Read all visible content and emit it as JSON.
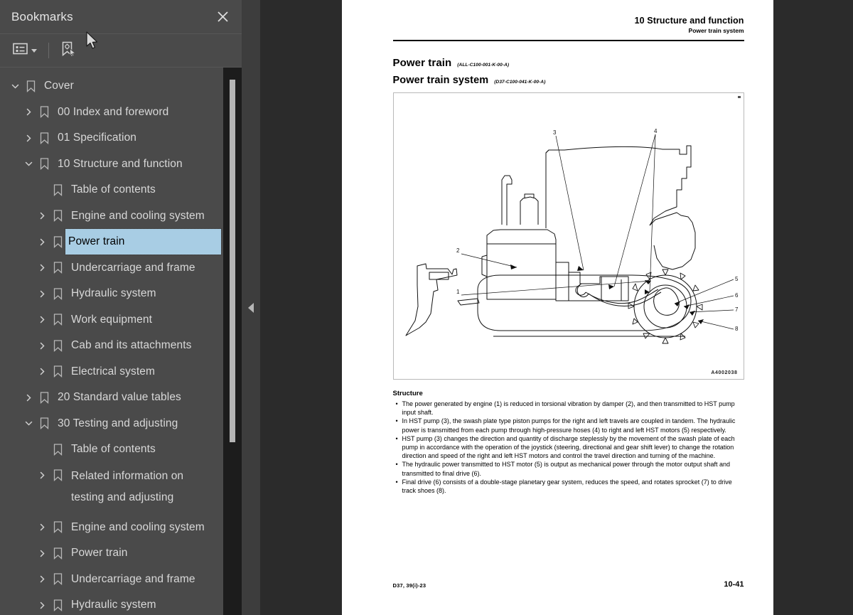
{
  "panel": {
    "title": "Bookmarks",
    "close_icon": "close-icon",
    "toolbar": {
      "list_options_label": "list-options-icon",
      "new_bookmark_label": "new-bookmark-icon"
    }
  },
  "bookmarks": [
    {
      "label": "Cover",
      "depth": 0,
      "state": "expanded"
    },
    {
      "label": "00 Index and foreword",
      "depth": 1,
      "state": "collapsed"
    },
    {
      "label": "01 Specification",
      "depth": 1,
      "state": "collapsed"
    },
    {
      "label": "10 Structure and function",
      "depth": 1,
      "state": "expanded"
    },
    {
      "label": "Table of contents",
      "depth": 2,
      "state": "leaf"
    },
    {
      "label": "Engine and cooling system",
      "depth": 2,
      "state": "collapsed"
    },
    {
      "label": "Power train",
      "depth": 2,
      "state": "collapsed",
      "selected": true
    },
    {
      "label": "Undercarriage and frame",
      "depth": 2,
      "state": "collapsed"
    },
    {
      "label": "Hydraulic system",
      "depth": 2,
      "state": "collapsed"
    },
    {
      "label": "Work equipment",
      "depth": 2,
      "state": "collapsed"
    },
    {
      "label": "Cab and its attachments",
      "depth": 2,
      "state": "collapsed"
    },
    {
      "label": "Electrical system",
      "depth": 2,
      "state": "collapsed"
    },
    {
      "label": "20 Standard value tables",
      "depth": 1,
      "state": "collapsed"
    },
    {
      "label": "30 Testing and adjusting",
      "depth": 1,
      "state": "expanded"
    },
    {
      "label": "Table of contents",
      "depth": 2,
      "state": "leaf"
    },
    {
      "label": "Related information on\ntesting and adjusting",
      "depth": 2,
      "state": "collapsed",
      "twoLine": true
    },
    {
      "label": "Engine and cooling system",
      "depth": 2,
      "state": "collapsed"
    },
    {
      "label": "Power train",
      "depth": 2,
      "state": "collapsed"
    },
    {
      "label": "Undercarriage and frame",
      "depth": 2,
      "state": "collapsed"
    },
    {
      "label": "Hydraulic system",
      "depth": 2,
      "state": "collapsed"
    }
  ],
  "page": {
    "header_chapter": "10 Structure and function",
    "header_section": "Power train system",
    "heading1": "Power train",
    "heading1_code": "(ALL-C100-001-K-00-A)",
    "heading2": "Power train system",
    "heading2_code": "(D37-C100-041-K-00-A)",
    "figure_id": "A4002038",
    "figure_callouts": [
      "1",
      "2",
      "3",
      "4",
      "5",
      "6",
      "7",
      "8"
    ],
    "structure_title": "Structure",
    "bullets": [
      "The power generated by engine (1) is reduced in torsional vibration by damper (2), and then transmitted to HST pump input shaft.",
      "In HST pump (3), the swash plate type piston pumps for the right and left travels are coupled in tandem. The hydraulic power is transmitted from each pump through high-pressure hoses (4) to right and left HST motors (5) respectively.",
      "HST pump (3) changes the direction and quantity of discharge steplessly by the movement of the swash plate of each pump in accordance with the operation of the joystick (steering, directional and gear shift lever) to change the rotation direction and speed of the right and left HST motors and control the travel direction and turning of the machine.",
      "The hydraulic power transmitted to HST motor (5) is output as mechanical power through the motor output shaft and transmitted to final drive (6).",
      "Final drive (6) consists of a double-stage planetary gear system, reduces the speed, and rotates sprocket (7) to drive track shoes (8)."
    ],
    "footer_left": "D37, 39(i)-23",
    "footer_right": "10-41"
  },
  "colors": {
    "sidebar_bg": "#4a4a4a",
    "viewer_bg": "#2b2b2b",
    "selection": "#a8cde4",
    "text": "#d8d8d8"
  }
}
